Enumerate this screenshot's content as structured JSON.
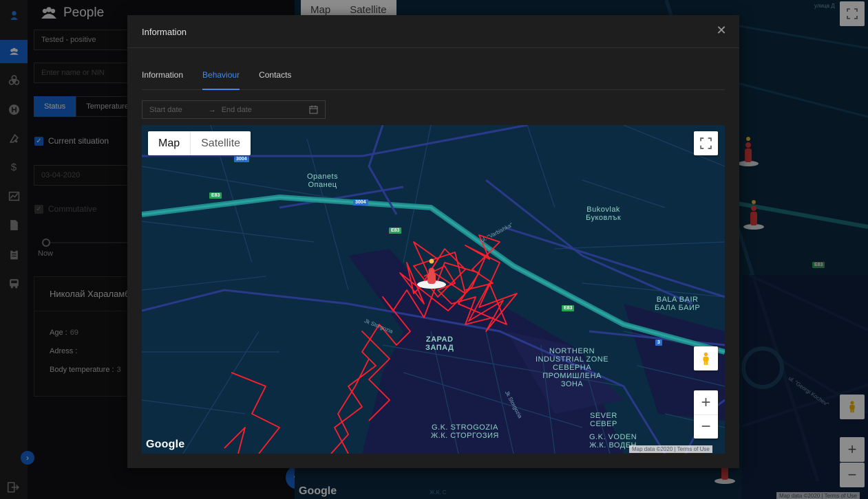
{
  "sidebar": {
    "items": [
      {
        "icon": "user-pin-icon"
      },
      {
        "icon": "people-icon"
      },
      {
        "icon": "biohazard-icon"
      },
      {
        "icon": "hospital-icon"
      },
      {
        "icon": "ambulance-icon"
      },
      {
        "icon": "dollar-icon"
      },
      {
        "icon": "chart-icon"
      },
      {
        "icon": "document-icon"
      },
      {
        "icon": "clipboard-icon"
      },
      {
        "icon": "bus-icon"
      }
    ],
    "active_index": 1
  },
  "people_panel": {
    "title": "People",
    "filter_value": "Tested - positive",
    "search_placeholder": "Enter name or NIN",
    "segments": [
      "Status",
      "Temperature"
    ],
    "current_situation_label": "Current situation",
    "date_value": "03-04-2020",
    "commutative_label": "Commutative",
    "slider_label": "Now",
    "card": {
      "name": "Николай Хараламб",
      "age_label": "Age :",
      "age_value": "69",
      "address_label": "Adress :",
      "temperature_label": "Body temperature :",
      "temperature_value": "3"
    },
    "add_label": "+",
    "collapse_label": "›"
  },
  "background_map": {
    "map_label": "Map",
    "satellite_label": "Satellite",
    "road_label": "ul. \"Georgi Kochev\"",
    "street_label": "улица Д",
    "e83": "E83",
    "attribution_data": "Map data ©2020",
    "attribution_terms": "Terms of Use",
    "google": "Google",
    "district": "Ж.К. С"
  },
  "modal": {
    "title": "Information",
    "tabs": [
      "Information",
      "Behaviour",
      "Contacts"
    ],
    "active_tab": 1,
    "start_placeholder": "Start date",
    "end_placeholder": "End date",
    "map": {
      "map_label": "Map",
      "satellite_label": "Satellite",
      "google": "Google",
      "attribution_data": "Map data ©2020",
      "attribution_terms": "Terms of Use",
      "labels": {
        "opanets_lat": "Opanets",
        "opanets_cyr": "Опанец",
        "bukovlak_lat": "Bukovlak",
        "bukovlak_cyr": "Буковлък",
        "bala_lat": "BALA BAIR",
        "bala_cyr": "БАЛА БАИР",
        "zapad_lat": "ZAPAD",
        "zapad_cyr": "ЗАПАД",
        "nz_lat": "NORTHERN INDUSTRIAL ZONE",
        "nz_cyr": "СЕВЕРНА ПРОМИШЛЕНА ЗОНА",
        "sever_lat": "SEVER",
        "sever_cyr": "СЕВЕР",
        "strog_lat": "G.K. STROGOZIA",
        "strog_cyr": "Ж.К. СТОРГОЗИЯ",
        "voden_lat": "G.K. VODEN",
        "voden_cyr": "Ж.К. ВОДЕН"
      },
      "shields": [
        "3004",
        "E83",
        "3004",
        "E83",
        "E83",
        "3"
      ],
      "roads": [
        "ul. \"Varbishka\"",
        "Jk Storgozia",
        "Jk Storgozia"
      ]
    }
  },
  "colors": {
    "accent": "#1668d6",
    "track": "#ff1f2d",
    "map_bg": "#0b2b42",
    "highway": "#1f8a8c"
  }
}
